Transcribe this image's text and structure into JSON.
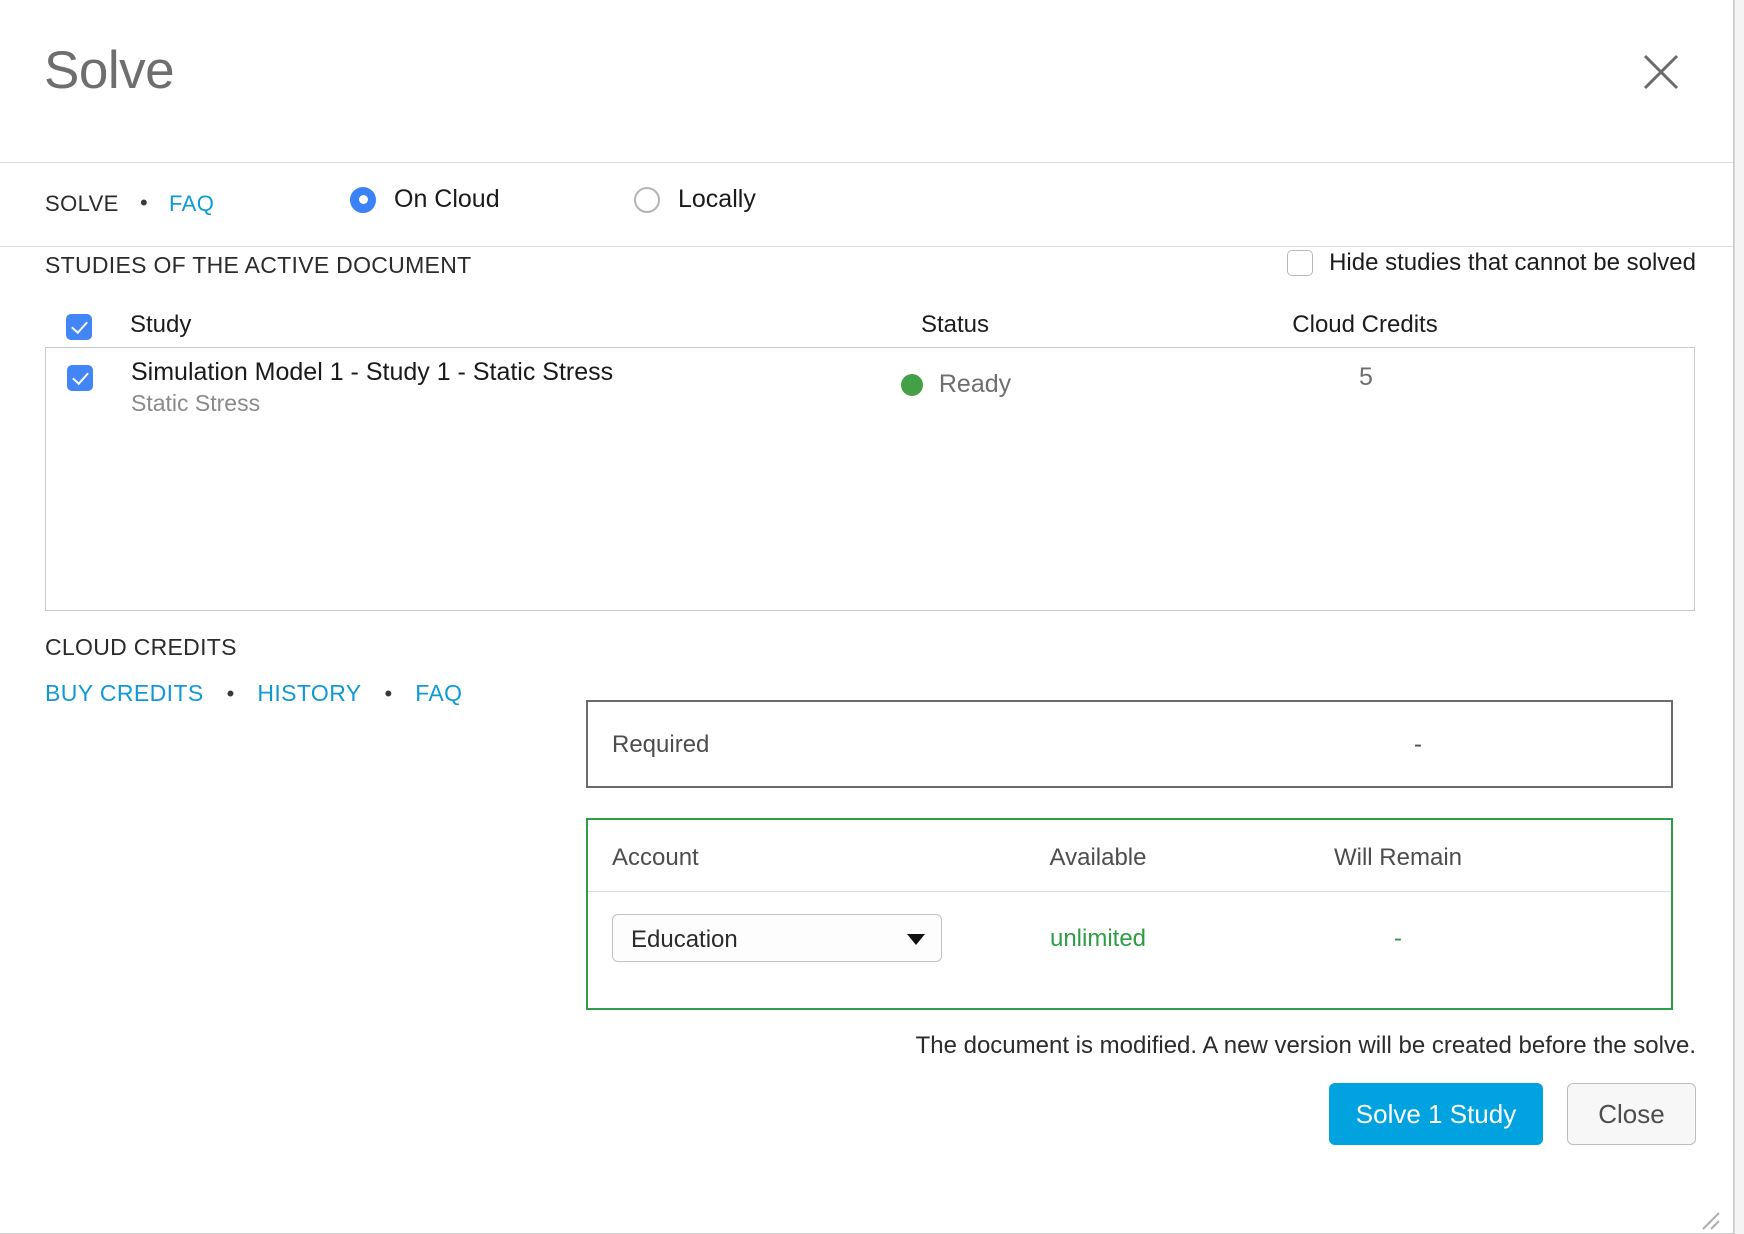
{
  "dialog": {
    "title": "Solve",
    "close_icon": "close-icon"
  },
  "mode_bar": {
    "solve_label": "SOLVE",
    "separator": "•",
    "faq_label": "FAQ",
    "options": [
      {
        "label": "On Cloud",
        "selected": true
      },
      {
        "label": "Locally",
        "selected": false
      }
    ]
  },
  "studies": {
    "heading": "STUDIES OF THE ACTIVE DOCUMENT",
    "hide_unsolvable_label": "Hide studies that cannot be solved",
    "hide_unsolvable_checked": false,
    "select_all_checked": true,
    "columns": {
      "study": "Study",
      "status": "Status",
      "cloud_credits": "Cloud Credits"
    },
    "rows": [
      {
        "checked": true,
        "title": "Simulation Model 1 - Study 1 - Static Stress",
        "subtitle": "Static Stress",
        "status": "Ready",
        "status_color": "#43a047",
        "cloud_credits": "5"
      }
    ]
  },
  "cloud_credits": {
    "heading": "CLOUD CREDITS",
    "separator": "•",
    "links": [
      {
        "label": "BUY CREDITS"
      },
      {
        "label": "HISTORY"
      },
      {
        "label": "FAQ"
      }
    ],
    "required": {
      "label": "Required",
      "value": "-"
    },
    "account_table": {
      "columns": {
        "account": "Account",
        "available": "Available",
        "will_remain": "Will Remain"
      },
      "row": {
        "account_selected": "Education",
        "available": "unlimited",
        "will_remain": "-"
      }
    }
  },
  "footer": {
    "note": "The document is modified. A new version will be created before the solve.",
    "solve_button": "Solve 1 Study",
    "close_button": "Close"
  },
  "colors": {
    "accent_blue": "#00a3e0",
    "link_blue": "#0f9ad6",
    "radio_blue": "#3b82f6",
    "checkbox_blue": "#4285f4",
    "status_green": "#43a047",
    "account_border_green": "#2e9e46"
  }
}
